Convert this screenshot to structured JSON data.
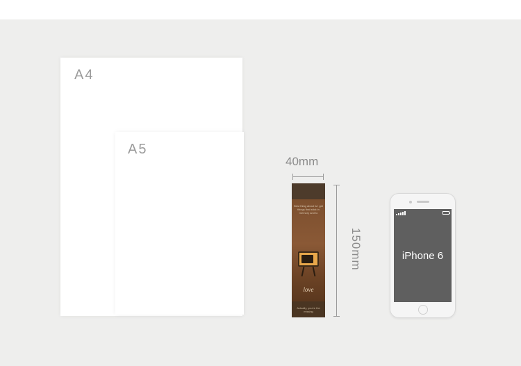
{
  "paper_sizes": {
    "a4_label": "A4",
    "a5_label": "A5"
  },
  "bookmark": {
    "width_label": "40mm",
    "height_label": "150mm",
    "top_text": "Best thing about is I get things that stick in memory and to",
    "script_word": "love",
    "bottom_text": "Actually, you're the missing"
  },
  "phone": {
    "model_label": "iPhone 6"
  }
}
